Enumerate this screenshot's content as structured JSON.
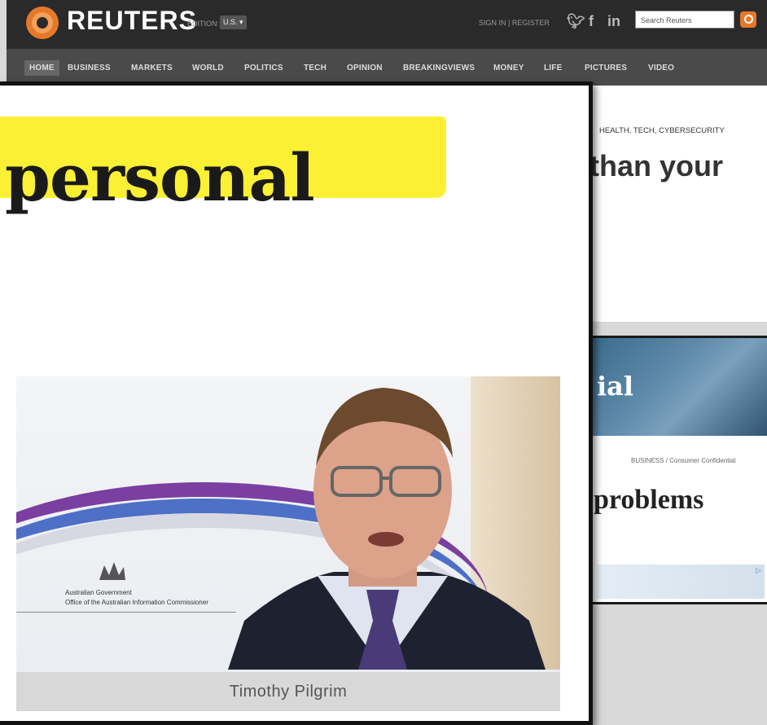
{
  "header": {
    "brand": "REUTERS",
    "edition_label": "EDITION:",
    "edition_value": "U.S.",
    "signin": "SIGN IN | REGISTER",
    "search_placeholder": "Search Reuters",
    "social": [
      "twitter-icon",
      "facebook-icon",
      "linkedin-icon"
    ],
    "accent_color": "#e6782a"
  },
  "nav": {
    "items": [
      {
        "label": "HOME"
      },
      {
        "label": "BUSINESS"
      },
      {
        "label": "MARKETS"
      },
      {
        "label": "WORLD"
      },
      {
        "label": "POLITICS"
      },
      {
        "label": "TECH"
      },
      {
        "label": "OPINION"
      },
      {
        "label": "BREAKINGVIEWS"
      },
      {
        "label": "MONEY"
      },
      {
        "label": "LIFE"
      },
      {
        "label": "PICTURES"
      },
      {
        "label": "VIDEO"
      }
    ]
  },
  "background_article": {
    "tags": "HEALTH, TECH, CYBERSECURITY",
    "headline_fragment": "than your"
  },
  "background_card": {
    "image_title": "ial",
    "kicker": "BUSINESS / Consumer Confidential",
    "headline_fragment": "problems"
  },
  "popup": {
    "highlight_word": "personal",
    "highlight_color": "#fbf033",
    "video": {
      "caption": "Timothy Pilgrim",
      "gov_lines": [
        "Australian Government",
        "Office of the Australian Information Commissioner"
      ]
    }
  }
}
